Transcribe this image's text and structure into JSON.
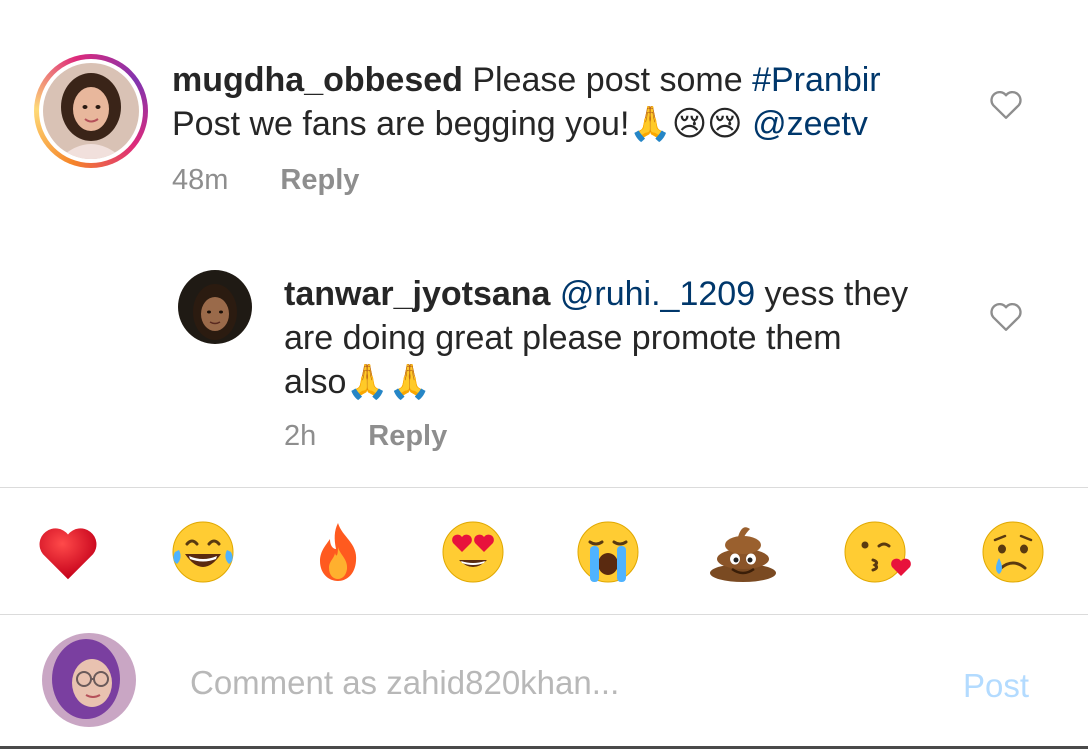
{
  "comments": [
    {
      "username": "mugdha_obbesed",
      "text_before": " Please post some ",
      "hashtag": "#Pranbir",
      "line2": "Post we fans are begging you!",
      "emojis": "🙏😢😢",
      "mention": "@zeetv",
      "time": "48m",
      "reply_label": "Reply"
    },
    {
      "username": "tanwar_jyotsana",
      "mention": "@ruhi._1209",
      "text_after": " yess they",
      "line2": "are doing great please promote them",
      "line3": "also",
      "emojis": "🙏🙏",
      "time": "2h",
      "reply_label": "Reply"
    }
  ],
  "quick_reactions": [
    {
      "name": "red-heart",
      "glyph": "❤️"
    },
    {
      "name": "laughing-tears",
      "glyph": "😂"
    },
    {
      "name": "fire",
      "glyph": "🔥"
    },
    {
      "name": "heart-eyes",
      "glyph": "😍"
    },
    {
      "name": "loudly-crying",
      "glyph": "😭"
    },
    {
      "name": "poop",
      "glyph": "💩"
    },
    {
      "name": "kissing-heart",
      "glyph": "😘"
    },
    {
      "name": "crying",
      "glyph": "😢"
    }
  ],
  "composer": {
    "placeholder": "Comment as zahid820khan...",
    "post_label": "Post"
  },
  "colors": {
    "link": "#00376b",
    "post_disabled": "#b3dbff",
    "muted": "#8e8e8e"
  }
}
